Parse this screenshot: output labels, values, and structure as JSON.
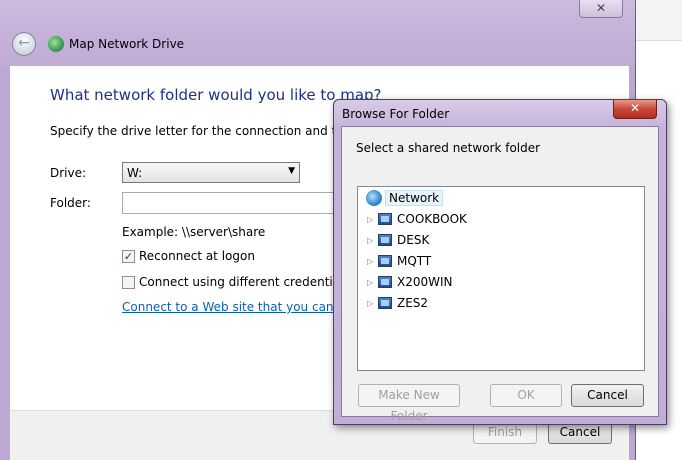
{
  "wizard": {
    "title": "Map Network Drive",
    "heading": "What network folder would you like to map?",
    "subtitle": "Specify the drive letter for the connection and the fold",
    "drive_label": "Drive:",
    "drive_value": "W:",
    "folder_label": "Folder:",
    "folder_value": "",
    "example": "Example: \\\\server\\share",
    "reconnect_label": "Reconnect at logon",
    "reconnect_checked": true,
    "credentials_label": "Connect using different credentials",
    "credentials_checked": false,
    "web_link": "Connect to a Web site that you can use t",
    "finish_label": "Finish",
    "cancel_label": "Cancel"
  },
  "browse": {
    "title": "Browse For Folder",
    "close_glyph": "✕",
    "prompt": "Select a shared network folder",
    "root": "Network",
    "items": [
      "COOKBOOK",
      "DESK",
      "MQTT",
      "X200WIN",
      "ZES2"
    ],
    "new_folder_label": "Make New Folder",
    "ok_label": "OK",
    "cancel_label": "Cancel"
  },
  "icons": {
    "back": "back-arrow-icon",
    "network": "network-globe-icon",
    "computer": "computer-icon",
    "expander": "triangle-right-icon"
  },
  "colors": {
    "heading": "#1e3287",
    "link": "#0d5faf",
    "frame": "#bda7d3",
    "close_red": "#c8473a"
  }
}
